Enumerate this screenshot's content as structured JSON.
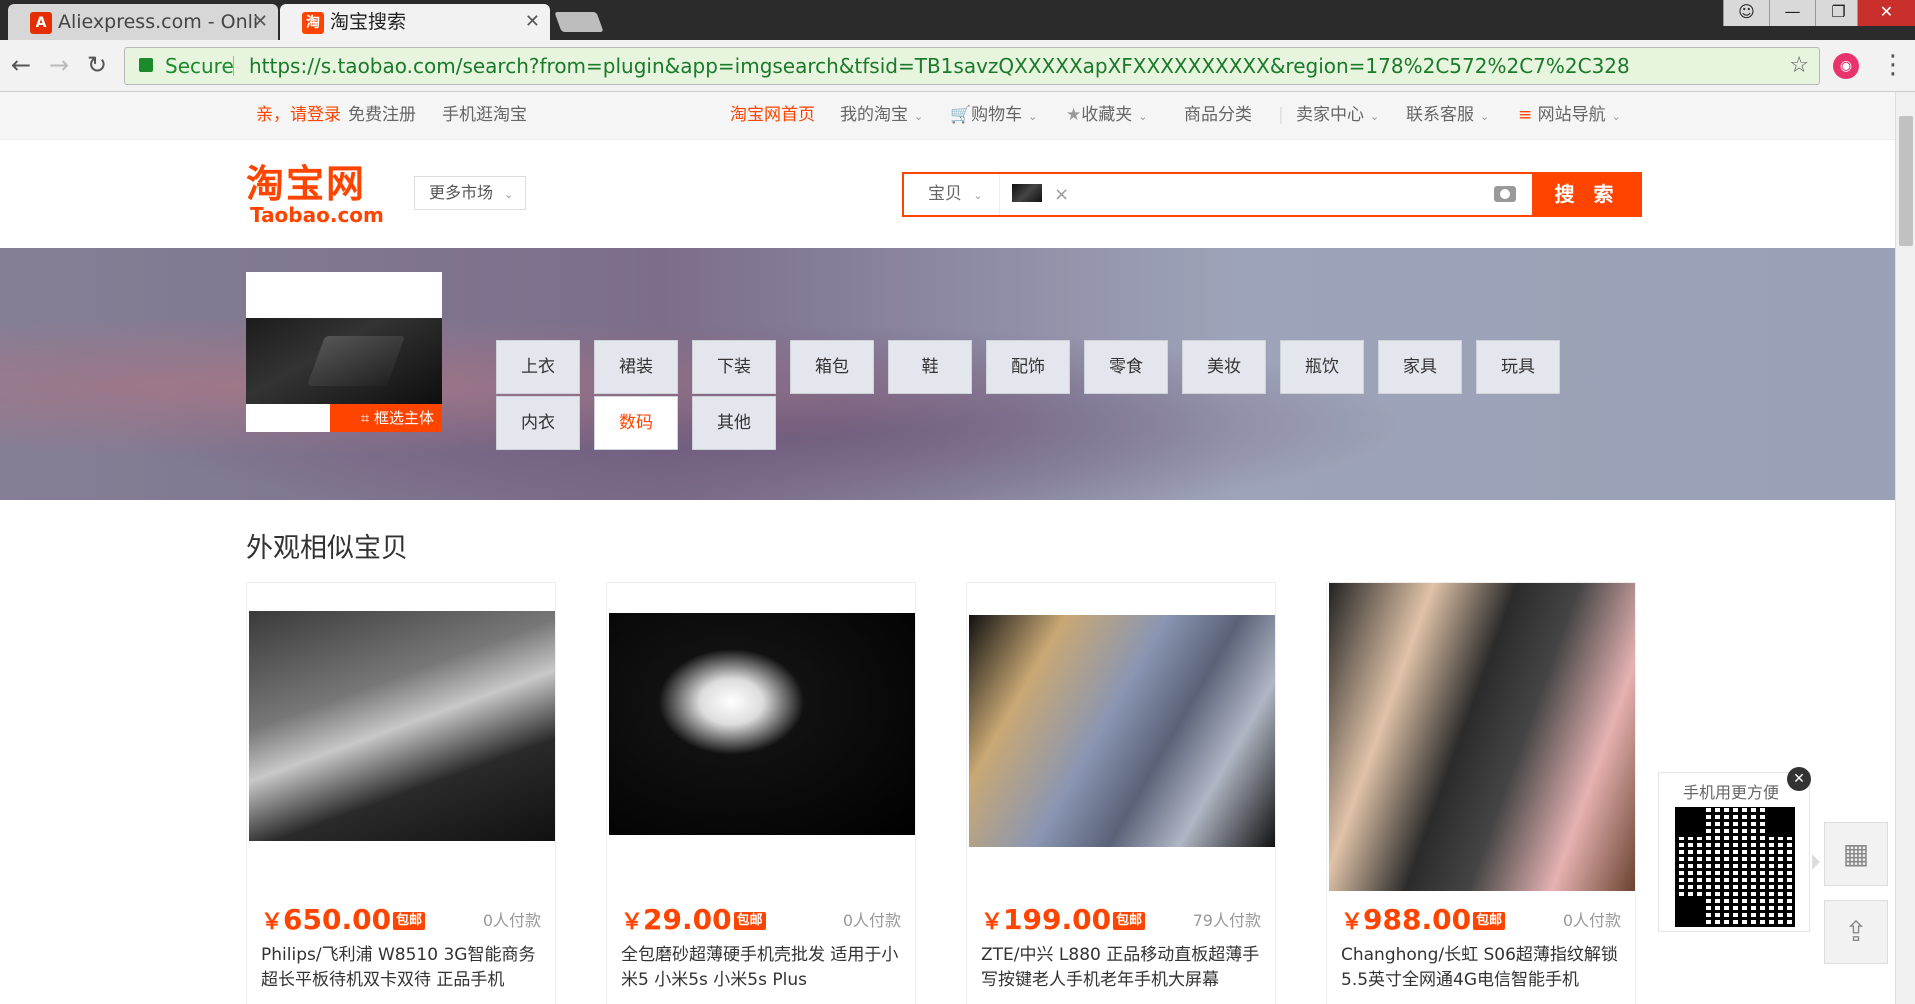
{
  "browser": {
    "tabs": [
      {
        "label": "Aliexpress.com - Onli",
        "favicon": "aliexpress-icon"
      },
      {
        "label": "淘宝搜索",
        "favicon": "taobao-icon"
      }
    ],
    "window_controls": {
      "user": "user-icon",
      "minimize": "—",
      "maximize": "❐",
      "close": "✕"
    },
    "secure_label": "Secure",
    "url": "https://s.taobao.com/search?from=plugin&app=imgsearch&tfsid=TB1savzQXXXXXapXFXXXXXXXXXX&region=178%2C572%2C7%2C328"
  },
  "sitenav": {
    "login": "亲，请登录",
    "register": "免费注册",
    "mobile": "手机逛淘宝",
    "home": "淘宝网首页",
    "my_taobao": "我的淘宝",
    "cart": "购物车",
    "favorites": "收藏夹",
    "categories": "商品分类",
    "seller_center": "卖家中心",
    "customer_service": "联系客服",
    "site_nav": "网站导航"
  },
  "header": {
    "logo_cn": "淘宝网",
    "logo_en": "Taobao.com",
    "more_market": "更多市场",
    "search_type": "宝贝",
    "search_button": "搜 索"
  },
  "banner": {
    "crop_label": "框选主体",
    "categories_row1": [
      "上衣",
      "裙装",
      "下装",
      "箱包",
      "鞋",
      "配饰",
      "零食",
      "美妆",
      "瓶饮",
      "家具",
      "玩具"
    ],
    "categories_row2": [
      "内衣",
      "数码",
      "其他"
    ],
    "active_category": "数码"
  },
  "results": {
    "section_title": "外观相似宝贝",
    "currency": "￥",
    "free_shipping": "包邮",
    "items": [
      {
        "price": "650.00",
        "paid": "0人付款",
        "title": "Philips/飞利浦 W8510 3G智能商务超长平板待机双卡双待 正品手机"
      },
      {
        "price": "29.00",
        "paid": "0人付款",
        "title": "全包磨砂超薄硬手机壳批发 适用于小米5 小米5s 小米5s Plus"
      },
      {
        "price": "199.00",
        "paid": "79人付款",
        "title": "ZTE/中兴 L880 正品移动直板超薄手写按键老人手机老年手机大屏幕"
      },
      {
        "price": "988.00",
        "paid": "0人付款",
        "title": "Changhong/长虹 S06超薄指纹解锁5.5英寸全网通4G电信智能手机"
      }
    ]
  },
  "side": {
    "qr_caption": "手机用更方便",
    "qr_close": "✕"
  },
  "colors": {
    "accent": "#ff4400",
    "chrome_dark": "#2b2b2b",
    "secure_green": "#1a8a2c"
  }
}
